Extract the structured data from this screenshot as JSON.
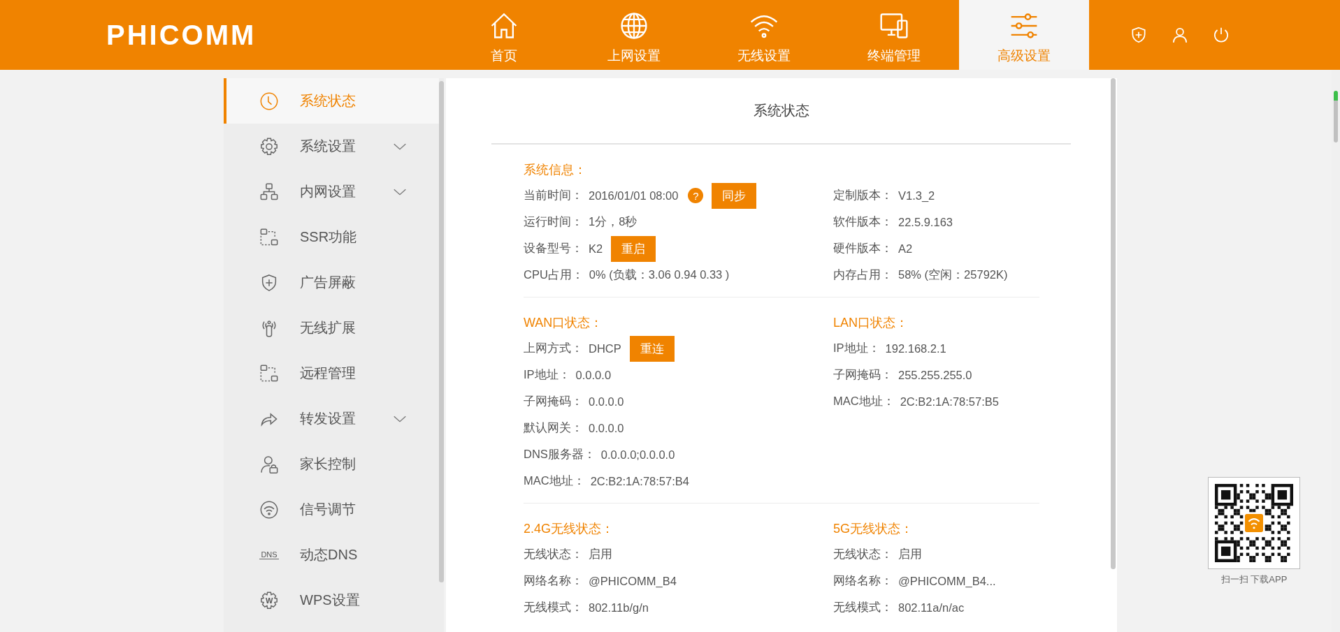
{
  "logo": "PHICOMM",
  "nav": [
    {
      "label": "首页",
      "kind": "home",
      "selected": false
    },
    {
      "label": "上网设置",
      "kind": "globe",
      "selected": false
    },
    {
      "label": "无线设置",
      "kind": "wifi",
      "selected": false
    },
    {
      "label": "终端管理",
      "kind": "devices",
      "selected": false
    },
    {
      "label": "高级设置",
      "kind": "sliders",
      "selected": true
    }
  ],
  "sidebar": {
    "items": [
      {
        "label": "系统状态",
        "kind": "clock",
        "has_submenu": false,
        "selected": true
      },
      {
        "label": "系统设置",
        "kind": "gear",
        "has_submenu": true,
        "selected": false
      },
      {
        "label": "内网设置",
        "kind": "network",
        "has_submenu": true,
        "selected": false
      },
      {
        "label": "SSR功能",
        "kind": "dashed",
        "has_submenu": false,
        "selected": false
      },
      {
        "label": "广告屏蔽",
        "kind": "shield",
        "has_submenu": false,
        "selected": false
      },
      {
        "label": "无线扩展",
        "kind": "antenna",
        "has_submenu": false,
        "selected": false
      },
      {
        "label": "远程管理",
        "kind": "dashed",
        "has_submenu": false,
        "selected": false
      },
      {
        "label": "转发设置",
        "kind": "share",
        "has_submenu": true,
        "selected": false
      },
      {
        "label": "家长控制",
        "kind": "userlock",
        "has_submenu": false,
        "selected": false
      },
      {
        "label": "信号调节",
        "kind": "signal",
        "has_submenu": false,
        "selected": false
      },
      {
        "label": "动态DNS",
        "kind": "text",
        "icon_text": "DNS",
        "has_submenu": false,
        "selected": false
      },
      {
        "label": "WPS设置",
        "kind": "gearletter",
        "icon_text": "W",
        "has_submenu": false,
        "selected": false
      }
    ]
  },
  "content": {
    "title": "系统状态",
    "bands": [
      {
        "left": {
          "heading": "系统信息：",
          "rows": [
            {
              "label": "当前时间：",
              "value": "2016/01/01 08:00",
              "help": "?",
              "button": "同步"
            },
            {
              "label": "运行时间：",
              "value": "1分，8秒"
            },
            {
              "label": "设备型号：",
              "value": "K2",
              "button": "重启"
            },
            {
              "label": "CPU占用：",
              "value": "0% (负载：3.06 0.94 0.33 )"
            }
          ]
        },
        "right": {
          "rows": [
            {
              "label": "定制版本：",
              "value": "V1.3_2"
            },
            {
              "label": "软件版本：",
              "value": "22.5.9.163"
            },
            {
              "label": "硬件版本：",
              "value": "A2"
            },
            {
              "label": "内存占用：",
              "value": "58% (空闲：25792K)"
            }
          ]
        }
      },
      {
        "left": {
          "heading": "WAN口状态：",
          "rows": [
            {
              "label": "上网方式：",
              "value": "DHCP",
              "button": "重连"
            },
            {
              "label": "IP地址：",
              "value": "0.0.0.0"
            },
            {
              "label": "子网掩码：",
              "value": "0.0.0.0"
            },
            {
              "label": "默认网关：",
              "value": "0.0.0.0"
            },
            {
              "label": "DNS服务器：",
              "value": "0.0.0.0;0.0.0.0"
            },
            {
              "label": "MAC地址：",
              "value": "2C:B2:1A:78:57:B4"
            }
          ]
        },
        "right": {
          "heading": "LAN口状态：",
          "rows": [
            {
              "label": "IP地址：",
              "value": "192.168.2.1"
            },
            {
              "label": "子网掩码：",
              "value": "255.255.255.0"
            },
            {
              "label": "MAC地址：",
              "value": "2C:B2:1A:78:57:B5"
            }
          ]
        }
      },
      {
        "left": {
          "heading": "2.4G无线状态：",
          "rows": [
            {
              "label": "无线状态：",
              "value": "启用"
            },
            {
              "label": "网络名称：",
              "value": "@PHICOMM_B4"
            },
            {
              "label": "无线模式：",
              "value": "802.11b/g/n"
            }
          ]
        },
        "right": {
          "heading": "5G无线状态：",
          "rows": [
            {
              "label": "无线状态：",
              "value": "启用"
            },
            {
              "label": "网络名称：",
              "value": "@PHICOMM_B4..."
            },
            {
              "label": "无线模式：",
              "value": "802.11a/n/ac"
            }
          ]
        }
      }
    ]
  },
  "qr": {
    "caption": "扫一扫 下载APP"
  }
}
